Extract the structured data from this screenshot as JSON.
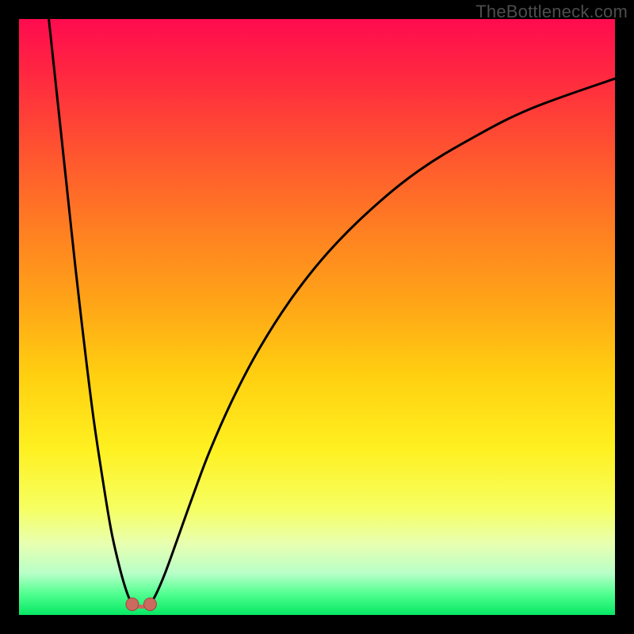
{
  "watermark": "TheBottleneck.com",
  "colors": {
    "frame": "#000000",
    "curve": "#000000",
    "marker_fill": "#cb6a5e",
    "marker_stroke": "#9b4a40",
    "gradient_stops": [
      {
        "offset": 0.0,
        "color": "#ff0b4f"
      },
      {
        "offset": 0.1,
        "color": "#ff2a3f"
      },
      {
        "offset": 0.22,
        "color": "#ff5330"
      },
      {
        "offset": 0.35,
        "color": "#ff7e22"
      },
      {
        "offset": 0.48,
        "color": "#ffa617"
      },
      {
        "offset": 0.6,
        "color": "#ffd010"
      },
      {
        "offset": 0.72,
        "color": "#fff020"
      },
      {
        "offset": 0.82,
        "color": "#f6ff60"
      },
      {
        "offset": 0.88,
        "color": "#e8ffb0"
      },
      {
        "offset": 0.93,
        "color": "#b8ffc8"
      },
      {
        "offset": 0.965,
        "color": "#50ff90"
      },
      {
        "offset": 1.0,
        "color": "#06e864"
      }
    ]
  },
  "chart_data": {
    "type": "line",
    "xlabel": "",
    "ylabel": "",
    "xlim": [
      0,
      100
    ],
    "ylim": [
      0,
      100
    ],
    "series": [
      {
        "name": "left-branch",
        "x": [
          5.0,
          6.5,
          8.0,
          9.5,
          11.0,
          12.5,
          14.0,
          15.5,
          17.0,
          18.2,
          19.0
        ],
        "y": [
          100,
          86,
          72,
          58,
          45,
          33,
          23,
          14,
          7.5,
          3.5,
          1.8
        ]
      },
      {
        "name": "right-branch",
        "x": [
          22.0,
          23.0,
          24.5,
          26.5,
          29.0,
          32.0,
          36.0,
          40.5,
          46.0,
          52.0,
          59.0,
          67.0,
          76.0,
          86.0,
          100.0
        ],
        "y": [
          1.8,
          3.5,
          7.0,
          12.5,
          19.5,
          27.5,
          36.5,
          45.0,
          53.5,
          61.0,
          68.0,
          74.5,
          80.0,
          85.0,
          90.0
        ]
      }
    ],
    "markers": [
      {
        "name": "min-left",
        "x": 19.0,
        "y": 1.8
      },
      {
        "name": "min-right",
        "x": 22.0,
        "y": 1.8
      }
    ],
    "flat_bottom_y": 1.5,
    "title": ""
  }
}
